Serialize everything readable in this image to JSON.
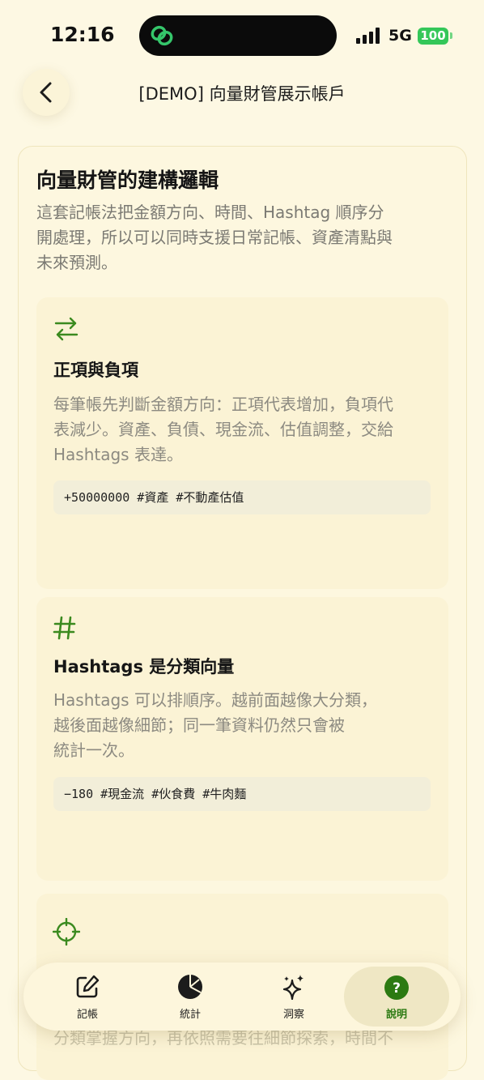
{
  "status_bar": {
    "time": "12:16",
    "network": "5G",
    "battery": "100"
  },
  "header": {
    "title": "[DEMO] 向量財管展示帳戶"
  },
  "card": {
    "title": "向量財管的建構邏輯",
    "description_lines": [
      "這套記帳法把金額方向、時間、Hashtag 順序分",
      "開處理，所以可以同時支援日常記帳、資產清點與",
      "未來預測。"
    ],
    "sections": [
      {
        "icon": "arrows-swap-icon",
        "title": "正項與負項",
        "description_lines": [
          "每筆帳先判斷金額方向：正項代表增加，負項代",
          "表減少。資產、負債、現金流、估值調整，交給",
          "Hashtags 表達。"
        ],
        "code": "+50000000 #資產 #不動產估值"
      },
      {
        "icon": "hash-icon",
        "title": "Hashtags 是分類向量",
        "description_lines": [
          "Hashtags 可以排順序。越前面越像大分類，",
          "越後面越像細節；同一筆資料仍然只會被",
          "統計一次。"
        ],
        "code": "−180 #現金流 #伙食費 #牛肉麵"
      },
      {
        "icon": "crosshair-icon",
        "partial_text": "分類掌握方向，再依照需要往細節探索，時間不"
      }
    ]
  },
  "tabbar": {
    "items": [
      {
        "label": "記帳",
        "icon": "edit-icon",
        "active": false
      },
      {
        "label": "統計",
        "icon": "pie-chart-icon",
        "active": false
      },
      {
        "label": "洞察",
        "icon": "sparkles-icon",
        "active": false
      },
      {
        "label": "說明",
        "icon": "help-icon",
        "active": true
      }
    ]
  },
  "colors": {
    "accent": "#2c7a12",
    "background": "#fdf8e3"
  }
}
